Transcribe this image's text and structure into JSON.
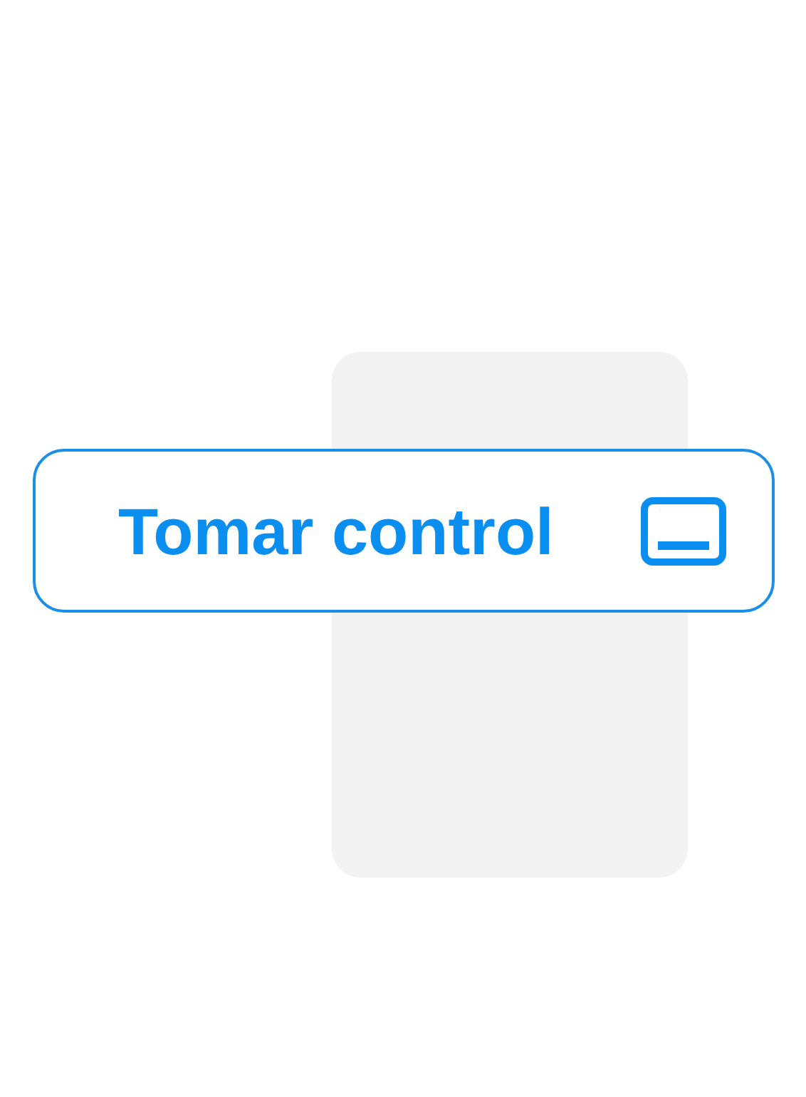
{
  "button": {
    "label": "Tomar control"
  }
}
